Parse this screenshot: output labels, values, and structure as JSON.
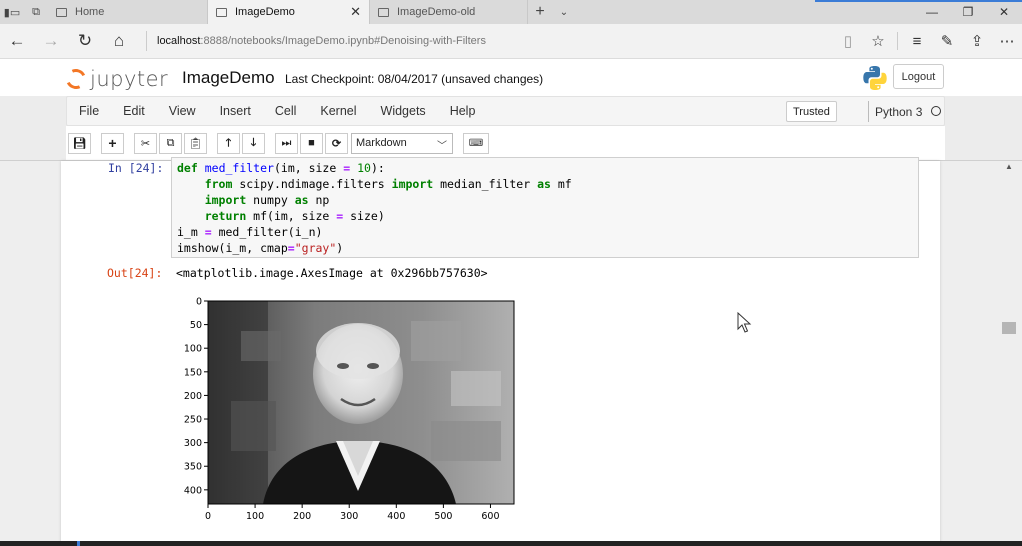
{
  "browser": {
    "tabs": [
      {
        "label": "Home",
        "active": false
      },
      {
        "label": "ImageDemo",
        "active": true
      },
      {
        "label": "ImageDemo-old",
        "active": false
      }
    ],
    "close_glyph": "✕",
    "new_tab_glyph": "+",
    "url_host": "localhost",
    "url_rest": ":8888/notebooks/ImageDemo.ipynb#Denoising-with-Filters"
  },
  "jupyter": {
    "logo_text": "jupyter",
    "notebook_title": "ImageDemo",
    "checkpoint": "Last Checkpoint: 08/04/2017 (unsaved changes)",
    "logout_label": "Logout",
    "menu": [
      "File",
      "Edit",
      "View",
      "Insert",
      "Cell",
      "Kernel",
      "Widgets",
      "Help"
    ],
    "trusted_label": "Trusted",
    "kernel_name": "Python 3",
    "cell_type": "Markdown"
  },
  "cell": {
    "in_prompt": "In [24]:",
    "out_prompt": "Out[24]:",
    "output_text": "<matplotlib.image.AxesImage at 0x296bb757630>"
  },
  "chart_data": {
    "type": "image",
    "x_ticks": [
      "0",
      "100",
      "200",
      "300",
      "400",
      "500",
      "600"
    ],
    "y_ticks": [
      "0",
      "50",
      "100",
      "150",
      "200",
      "250",
      "300",
      "350",
      "400"
    ],
    "xlim": [
      0,
      650
    ],
    "ylim": [
      430,
      0
    ],
    "colormap": "gray"
  },
  "colors": {
    "accent_blue": "#3b7cd6",
    "jupyter_orange": "#f37726",
    "in_prompt": "#303f9f",
    "out_prompt": "#d84315"
  }
}
